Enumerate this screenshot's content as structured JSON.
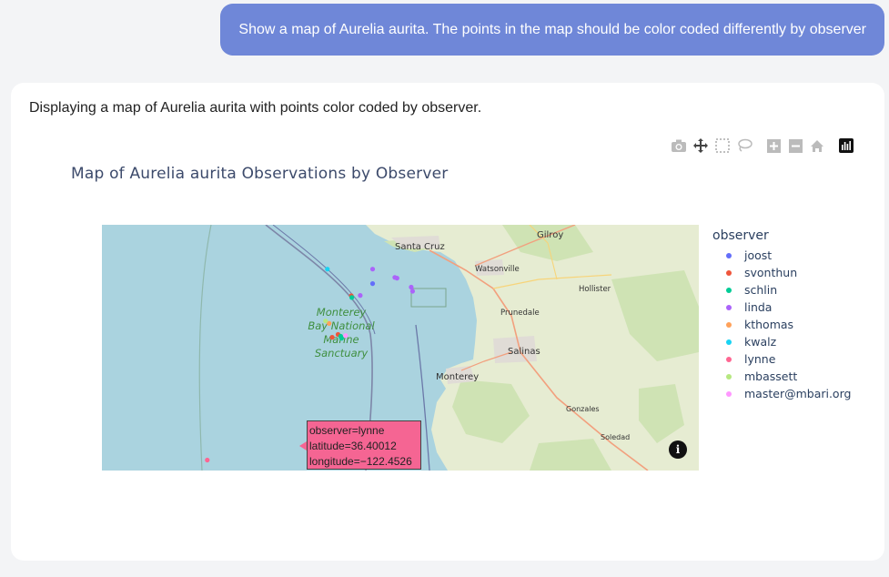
{
  "user_message": "Show a map of Aurelia aurita. The points in the map should be color coded differently by observer",
  "assistant_message": "Displaying a map of Aurelia aurita with points color coded by observer.",
  "modebar": {
    "buttons": [
      {
        "name": "camera-icon",
        "label": "Download plot as png"
      },
      {
        "name": "pan-icon",
        "label": "Pan"
      },
      {
        "name": "box-select-icon",
        "label": "Box Select"
      },
      {
        "name": "lasso-icon",
        "label": "Lasso Select"
      },
      {
        "name": "zoom-in-icon",
        "label": "Zoom in"
      },
      {
        "name": "zoom-out-icon",
        "label": "Zoom out"
      },
      {
        "name": "home-icon",
        "label": "Reset view"
      },
      {
        "name": "plotly-logo-icon",
        "label": "Produced with Plotly"
      }
    ]
  },
  "chart": {
    "title": "Map of Aurelia aurita Observations by Observer",
    "legend_title": "observer"
  },
  "chart_data": {
    "type": "scatter",
    "title": "Map of Aurelia aurita Observations by Observer",
    "legend_title": "observer",
    "legend_placement": "right",
    "series": [
      {
        "name": "joost",
        "color": "#636efa",
        "points": [
          [
            -122.08,
            36.91
          ]
        ]
      },
      {
        "name": "svonthun",
        "color": "#ef553b",
        "points": [
          [
            -122.128,
            36.875
          ],
          [
            -122.158,
            36.763
          ],
          [
            -122.171,
            36.755
          ]
        ]
      },
      {
        "name": "schlin",
        "color": "#00cc96",
        "points": [
          [
            -122.127,
            36.87
          ],
          [
            -122.152,
            36.758
          ],
          [
            -122.15,
            36.752
          ]
        ]
      },
      {
        "name": "linda",
        "color": "#ab63fa",
        "points": [
          [
            -122.08,
            36.952
          ],
          [
            -122.03,
            36.928
          ],
          [
            -122.025,
            36.926
          ],
          [
            -121.993,
            36.9
          ],
          [
            -121.99,
            36.888
          ],
          [
            -122.108,
            36.876
          ]
        ]
      },
      {
        "name": "kthomas",
        "color": "#ffa15a",
        "points": [
          [
            -122.178,
            36.795
          ]
        ]
      },
      {
        "name": "kwalz",
        "color": "#19d3f3",
        "points": [
          [
            -122.182,
            36.952
          ]
        ]
      },
      {
        "name": "lynne",
        "color": "#ff6692",
        "points": [
          [
            -122.4526,
            36.40012
          ]
        ]
      },
      {
        "name": "mbassett",
        "color": "#b6e880",
        "points": [
          [
            -122.186,
            36.802
          ]
        ]
      },
      {
        "name": "master@mbari.org",
        "color": "#ff97ff",
        "points": [
          [
            -122.141,
            36.76
          ]
        ]
      }
    ],
    "map_labels": [
      "Santa Cruz",
      "Gilroy",
      "Watsonville",
      "Hollister",
      "Prunedale",
      "Salinas",
      "Monterey",
      "Gonzales",
      "Soledad",
      "Monterey Bay National Marine Sanctuary"
    ]
  },
  "map": {
    "labels": {
      "santa_cruz": "Santa Cruz",
      "gilroy": "Gilroy",
      "watsonville": "Watsonville",
      "hollister": "Hollister",
      "prunedale": "Prunedale",
      "salinas": "Salinas",
      "monterey": "Monterey",
      "gonzales": "Gonzales",
      "soledad": "Soledad",
      "sanctuary_1": "Monterey",
      "sanctuary_2": "Bay National",
      "sanctuary_3": "Marine",
      "sanctuary_4": "Sanctuary"
    },
    "colors": {
      "ocean": "#aad3df",
      "land": "#e6ecd2",
      "green": "#cfe3b4"
    }
  },
  "tooltip": {
    "line1": "observer=lynne",
    "line2": "latitude=36.40012",
    "line3": "longitude=−122.4526"
  },
  "info_button": "i"
}
